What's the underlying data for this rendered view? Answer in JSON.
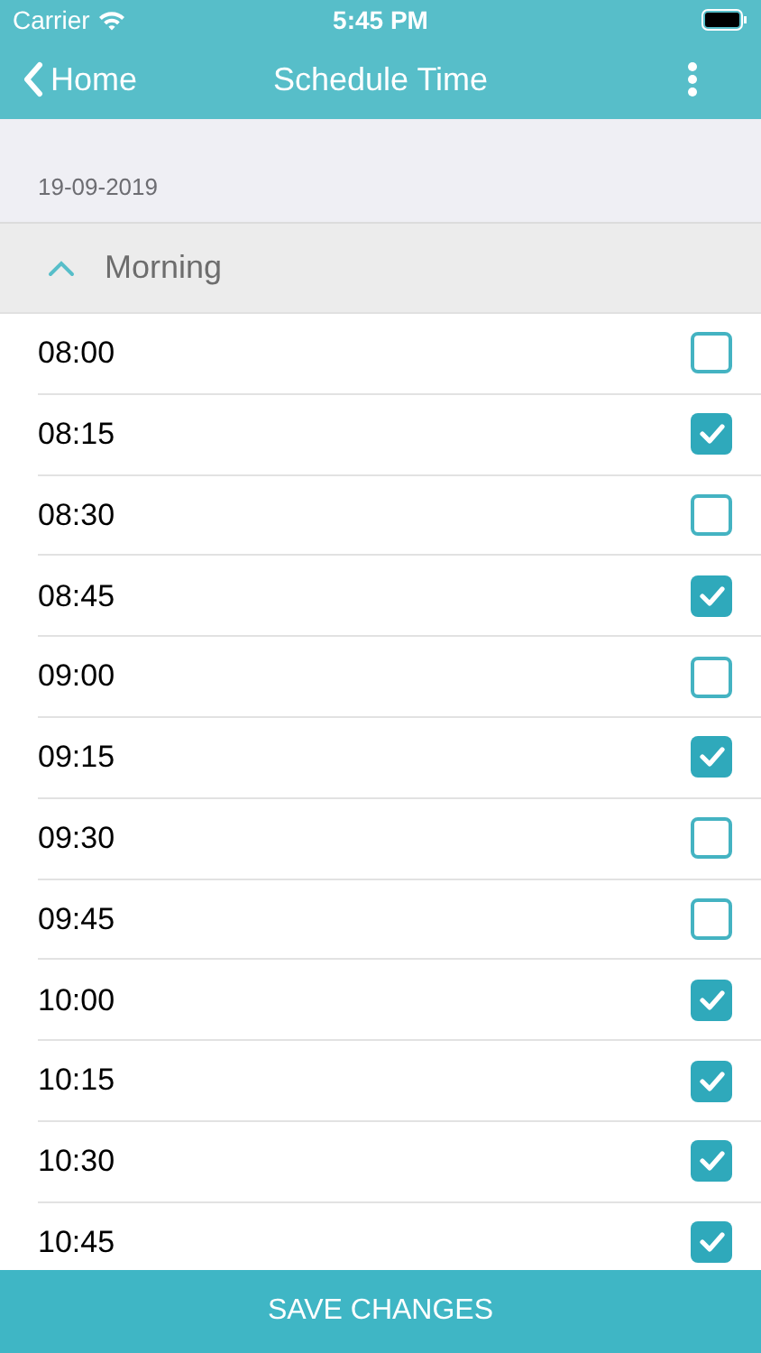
{
  "status_bar": {
    "carrier": "Carrier",
    "time": "5:45 PM"
  },
  "nav_bar": {
    "back": "Home",
    "title": "Schedule Time"
  },
  "date": "19-09-2019",
  "section": {
    "title": "Morning",
    "expanded": true
  },
  "slots": [
    {
      "time": "08:00",
      "checked": false
    },
    {
      "time": "08:15",
      "checked": true
    },
    {
      "time": "08:30",
      "checked": false
    },
    {
      "time": "08:45",
      "checked": true
    },
    {
      "time": "09:00",
      "checked": false
    },
    {
      "time": "09:15",
      "checked": true
    },
    {
      "time": "09:30",
      "checked": false
    },
    {
      "time": "09:45",
      "checked": false
    },
    {
      "time": "10:00",
      "checked": true
    },
    {
      "time": "10:15",
      "checked": true
    },
    {
      "time": "10:30",
      "checked": true
    },
    {
      "time": "10:45",
      "checked": true
    }
  ],
  "save_button": "SAVE CHANGES"
}
